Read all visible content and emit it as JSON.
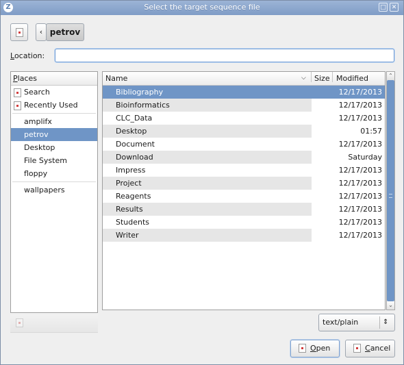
{
  "window": {
    "title": "Select the target sequence file",
    "app_icon": "Z"
  },
  "pathbar": {
    "back_glyph": "‹",
    "current": "petrov"
  },
  "location": {
    "label_first": "L",
    "label_rest": "ocation:",
    "value": ""
  },
  "places": {
    "header_first": "P",
    "header_rest": "laces",
    "items": [
      {
        "label": "Search",
        "icon": "document-icon"
      },
      {
        "label": "Recently Used",
        "icon": "document-icon"
      },
      {
        "label": "amplifx"
      },
      {
        "label": "petrov",
        "selected": true
      },
      {
        "label": "Desktop"
      },
      {
        "label": "File System"
      },
      {
        "label": "floppy"
      }
    ],
    "bookmarks": [
      {
        "label": "wallpapers"
      }
    ]
  },
  "files": {
    "columns": {
      "name": "Name",
      "size": "Size",
      "modified": "Modified"
    },
    "rows": [
      {
        "name": "Bibliography",
        "modified": "12/17/2013"
      },
      {
        "name": "Bioinformatics",
        "modified": "12/17/2013"
      },
      {
        "name": "CLC_Data",
        "modified": "12/17/2013"
      },
      {
        "name": "Desktop",
        "modified": "01:57"
      },
      {
        "name": "Document",
        "modified": "12/17/2013"
      },
      {
        "name": "Download",
        "modified": "Saturday"
      },
      {
        "name": "Impress",
        "modified": "12/17/2013"
      },
      {
        "name": "Project",
        "modified": "12/17/2013"
      },
      {
        "name": "Reagents",
        "modified": "12/17/2013"
      },
      {
        "name": "Results",
        "modified": "12/17/2013"
      },
      {
        "name": "Students",
        "modified": "12/17/2013"
      },
      {
        "name": "Writer",
        "modified": "12/17/2013"
      }
    ]
  },
  "filter": {
    "selected": "text/plain"
  },
  "buttons": {
    "open_first": "O",
    "open_rest": "pen",
    "cancel_first": "C",
    "cancel_rest": "ancel"
  },
  "colors": {
    "selection": "#6f95c6",
    "titlebar": "#8ba6cc"
  }
}
